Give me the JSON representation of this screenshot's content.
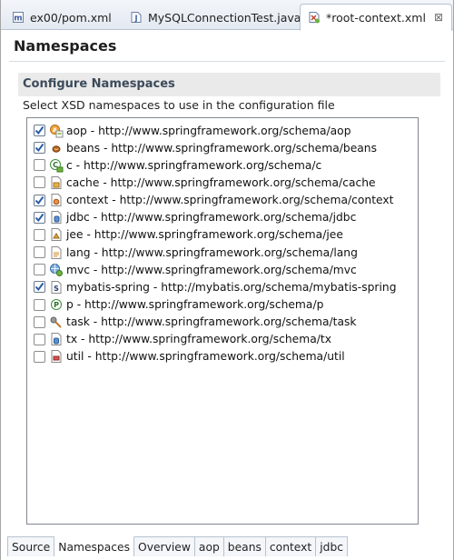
{
  "editor_tabs": [
    {
      "label": "ex00/pom.xml",
      "icon": "maven-pom-icon"
    },
    {
      "label": "MySQLConnectionTest.java",
      "icon": "java-file-icon"
    },
    {
      "label": "*root-context.xml",
      "icon": "spring-xml-icon",
      "close": "⊠"
    }
  ],
  "page": {
    "title": "Namespaces"
  },
  "section": {
    "title": "Configure Namespaces",
    "description": "Select XSD namespaces to use in the configuration file"
  },
  "namespaces": [
    {
      "label": "aop - http://www.springframework.org/schema/aop",
      "checked": true,
      "icon": "aop-icon"
    },
    {
      "label": "beans - http://www.springframework.org/schema/beans",
      "checked": true,
      "icon": "bean-icon"
    },
    {
      "label": "c - http://www.springframework.org/schema/c",
      "checked": false,
      "icon": "c-namespace-icon"
    },
    {
      "label": "cache - http://www.springframework.org/schema/cache",
      "checked": false,
      "icon": "cache-icon"
    },
    {
      "label": "context - http://www.springframework.org/schema/context",
      "checked": true,
      "icon": "context-icon"
    },
    {
      "label": "jdbc - http://www.springframework.org/schema/jdbc",
      "checked": true,
      "icon": "jdbc-icon"
    },
    {
      "label": "jee - http://www.springframework.org/schema/jee",
      "checked": false,
      "icon": "jee-icon"
    },
    {
      "label": "lang - http://www.springframework.org/schema/lang",
      "checked": false,
      "icon": "lang-icon"
    },
    {
      "label": "mvc - http://www.springframework.org/schema/mvc",
      "checked": false,
      "icon": "mvc-icon"
    },
    {
      "label": "mybatis-spring - http://mybatis.org/schema/mybatis-spring",
      "checked": true,
      "icon": "mybatis-icon"
    },
    {
      "label": "p - http://www.springframework.org/schema/p",
      "checked": false,
      "icon": "p-namespace-icon"
    },
    {
      "label": "task - http://www.springframework.org/schema/task",
      "checked": false,
      "icon": "task-icon"
    },
    {
      "label": "tx - http://www.springframework.org/schema/tx",
      "checked": false,
      "icon": "tx-icon"
    },
    {
      "label": "util - http://www.springframework.org/schema/util",
      "checked": false,
      "icon": "util-icon"
    }
  ],
  "bottom_tabs": [
    {
      "label": "Source",
      "active": false
    },
    {
      "label": "Namespaces",
      "active": true
    },
    {
      "label": "Overview",
      "active": false
    },
    {
      "label": "aop",
      "active": false
    },
    {
      "label": "beans",
      "active": false
    },
    {
      "label": "context",
      "active": false
    },
    {
      "label": "jdbc",
      "active": false
    }
  ],
  "colors": {
    "section_title": "#3c4a59",
    "check_mark": "#2a5aa8",
    "spring_green": "#6db33f",
    "tab_border": "#b7c3d1"
  }
}
